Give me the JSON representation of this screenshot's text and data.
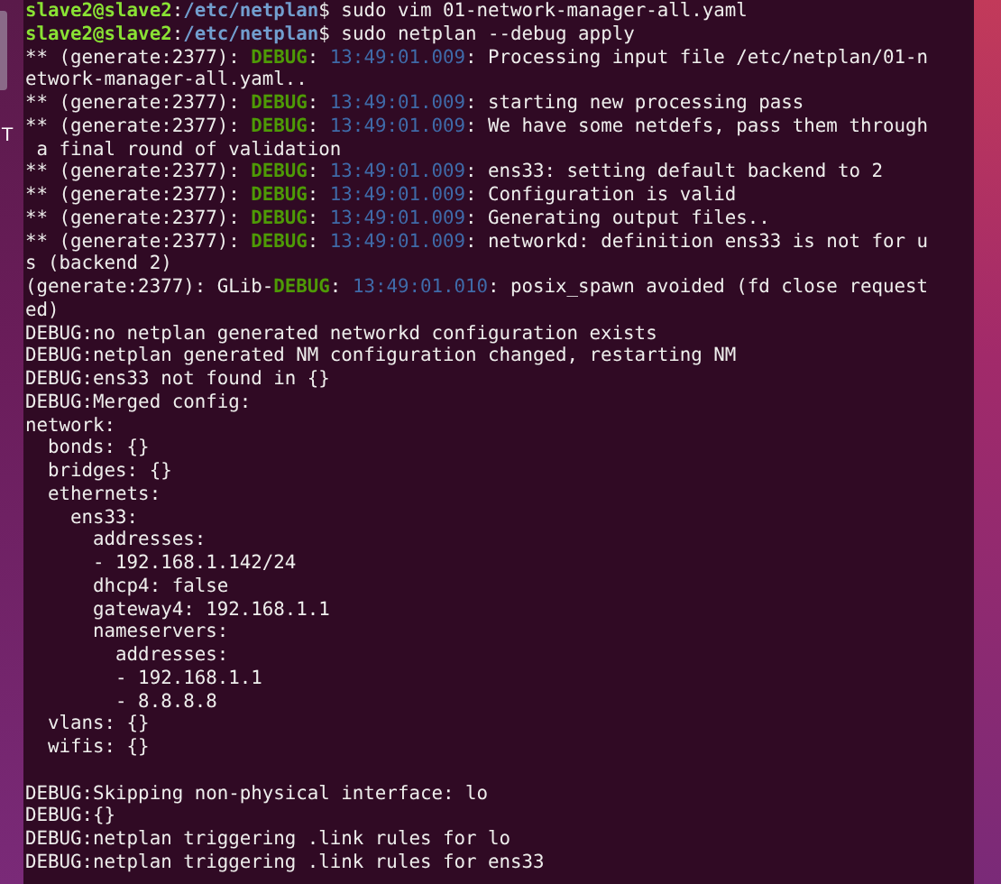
{
  "desktop": {
    "icon_label": "T"
  },
  "terminal": {
    "lines": [
      {
        "kind": "text",
        "segments": [
          {
            "kind": "user",
            "text": "slave2@slave2"
          },
          {
            "kind": "plain",
            "text": ":"
          },
          {
            "kind": "path",
            "text": "/etc/netplan"
          },
          {
            "kind": "plain",
            "text": "$ sudo vim 01-network-manager-all.yaml"
          }
        ]
      },
      {
        "kind": "text",
        "segments": [
          {
            "kind": "user",
            "text": "slave2@slave2"
          },
          {
            "kind": "plain",
            "text": ":"
          },
          {
            "kind": "path",
            "text": "/etc/netplan"
          },
          {
            "kind": "plain",
            "text": "$ sudo netplan --debug apply"
          }
        ]
      },
      {
        "kind": "text",
        "segments": [
          {
            "kind": "plain",
            "text": "** (generate:2377): "
          },
          {
            "kind": "debug",
            "text": "DEBUG"
          },
          {
            "kind": "plain",
            "text": ": "
          },
          {
            "kind": "time",
            "text": "13:49:01.009"
          },
          {
            "kind": "plain",
            "text": ": Processing input file /etc/netplan/01-n"
          }
        ]
      },
      {
        "kind": "text",
        "segments": [
          {
            "kind": "plain",
            "text": "etwork-manager-all.yaml.."
          }
        ]
      },
      {
        "kind": "text",
        "segments": [
          {
            "kind": "plain",
            "text": "** (generate:2377): "
          },
          {
            "kind": "debug",
            "text": "DEBUG"
          },
          {
            "kind": "plain",
            "text": ": "
          },
          {
            "kind": "time",
            "text": "13:49:01.009"
          },
          {
            "kind": "plain",
            "text": ": starting new processing pass"
          }
        ]
      },
      {
        "kind": "text",
        "segments": [
          {
            "kind": "plain",
            "text": "** (generate:2377): "
          },
          {
            "kind": "debug",
            "text": "DEBUG"
          },
          {
            "kind": "plain",
            "text": ": "
          },
          {
            "kind": "time",
            "text": "13:49:01.009"
          },
          {
            "kind": "plain",
            "text": ": We have some netdefs, pass them through"
          }
        ]
      },
      {
        "kind": "text",
        "segments": [
          {
            "kind": "plain",
            "text": " a final round of validation"
          }
        ]
      },
      {
        "kind": "text",
        "segments": [
          {
            "kind": "plain",
            "text": "** (generate:2377): "
          },
          {
            "kind": "debug",
            "text": "DEBUG"
          },
          {
            "kind": "plain",
            "text": ": "
          },
          {
            "kind": "time",
            "text": "13:49:01.009"
          },
          {
            "kind": "plain",
            "text": ": ens33: setting default backend to 2"
          }
        ]
      },
      {
        "kind": "text",
        "segments": [
          {
            "kind": "plain",
            "text": "** (generate:2377): "
          },
          {
            "kind": "debug",
            "text": "DEBUG"
          },
          {
            "kind": "plain",
            "text": ": "
          },
          {
            "kind": "time",
            "text": "13:49:01.009"
          },
          {
            "kind": "plain",
            "text": ": Configuration is valid"
          }
        ]
      },
      {
        "kind": "text",
        "segments": [
          {
            "kind": "plain",
            "text": "** (generate:2377): "
          },
          {
            "kind": "debug",
            "text": "DEBUG"
          },
          {
            "kind": "plain",
            "text": ": "
          },
          {
            "kind": "time",
            "text": "13:49:01.009"
          },
          {
            "kind": "plain",
            "text": ": Generating output files.."
          }
        ]
      },
      {
        "kind": "text",
        "segments": [
          {
            "kind": "plain",
            "text": "** (generate:2377): "
          },
          {
            "kind": "debug",
            "text": "DEBUG"
          },
          {
            "kind": "plain",
            "text": ": "
          },
          {
            "kind": "time",
            "text": "13:49:01.009"
          },
          {
            "kind": "plain",
            "text": ": networkd: definition ens33 is not for u"
          }
        ]
      },
      {
        "kind": "text",
        "segments": [
          {
            "kind": "plain",
            "text": "s (backend 2)"
          }
        ]
      },
      {
        "kind": "text",
        "segments": [
          {
            "kind": "plain",
            "text": "(generate:2377): GLib-"
          },
          {
            "kind": "debug",
            "text": "DEBUG"
          },
          {
            "kind": "plain",
            "text": ": "
          },
          {
            "kind": "time",
            "text": "13:49:01.010"
          },
          {
            "kind": "plain",
            "text": ": posix_spawn avoided (fd close request"
          }
        ]
      },
      {
        "kind": "text",
        "segments": [
          {
            "kind": "plain",
            "text": "ed)"
          }
        ]
      },
      {
        "kind": "text",
        "segments": [
          {
            "kind": "plain",
            "text": "DEBUG:no netplan generated networkd configuration exists"
          }
        ]
      },
      {
        "kind": "text",
        "segments": [
          {
            "kind": "plain",
            "text": "DEBUG:netplan generated NM configuration changed, restarting NM"
          }
        ]
      },
      {
        "kind": "text",
        "segments": [
          {
            "kind": "plain",
            "text": "DEBUG:ens33 not found in {}"
          }
        ]
      },
      {
        "kind": "text",
        "segments": [
          {
            "kind": "plain",
            "text": "DEBUG:Merged config:"
          }
        ]
      },
      {
        "kind": "text",
        "segments": [
          {
            "kind": "plain",
            "text": "network:"
          }
        ]
      },
      {
        "kind": "text",
        "segments": [
          {
            "kind": "plain",
            "text": "  bonds: {}"
          }
        ]
      },
      {
        "kind": "text",
        "segments": [
          {
            "kind": "plain",
            "text": "  bridges: {}"
          }
        ]
      },
      {
        "kind": "text",
        "segments": [
          {
            "kind": "plain",
            "text": "  ethernets:"
          }
        ]
      },
      {
        "kind": "text",
        "segments": [
          {
            "kind": "plain",
            "text": "    ens33:"
          }
        ]
      },
      {
        "kind": "text",
        "segments": [
          {
            "kind": "plain",
            "text": "      addresses:"
          }
        ]
      },
      {
        "kind": "text",
        "segments": [
          {
            "kind": "plain",
            "text": "      - 192.168.1.142/24"
          }
        ]
      },
      {
        "kind": "text",
        "segments": [
          {
            "kind": "plain",
            "text": "      dhcp4: false"
          }
        ]
      },
      {
        "kind": "text",
        "segments": [
          {
            "kind": "plain",
            "text": "      gateway4: 192.168.1.1"
          }
        ]
      },
      {
        "kind": "text",
        "segments": [
          {
            "kind": "plain",
            "text": "      nameservers:"
          }
        ]
      },
      {
        "kind": "text",
        "segments": [
          {
            "kind": "plain",
            "text": "        addresses:"
          }
        ]
      },
      {
        "kind": "text",
        "segments": [
          {
            "kind": "plain",
            "text": "        - 192.168.1.1"
          }
        ]
      },
      {
        "kind": "text",
        "segments": [
          {
            "kind": "plain",
            "text": "        - 8.8.8.8"
          }
        ]
      },
      {
        "kind": "text",
        "segments": [
          {
            "kind": "plain",
            "text": "  vlans: {}"
          }
        ]
      },
      {
        "kind": "text",
        "segments": [
          {
            "kind": "plain",
            "text": "  wifis: {}"
          }
        ]
      },
      {
        "kind": "blank"
      },
      {
        "kind": "text",
        "segments": [
          {
            "kind": "plain",
            "text": "DEBUG:Skipping non-physical interface: lo"
          }
        ]
      },
      {
        "kind": "text",
        "segments": [
          {
            "kind": "plain",
            "text": "DEBUG:{}"
          }
        ]
      },
      {
        "kind": "text",
        "segments": [
          {
            "kind": "plain",
            "text": "DEBUG:netplan triggering .link rules for lo"
          }
        ]
      },
      {
        "kind": "text",
        "segments": [
          {
            "kind": "plain",
            "text": "DEBUG:netplan triggering .link rules for ens33"
          }
        ]
      }
    ]
  }
}
